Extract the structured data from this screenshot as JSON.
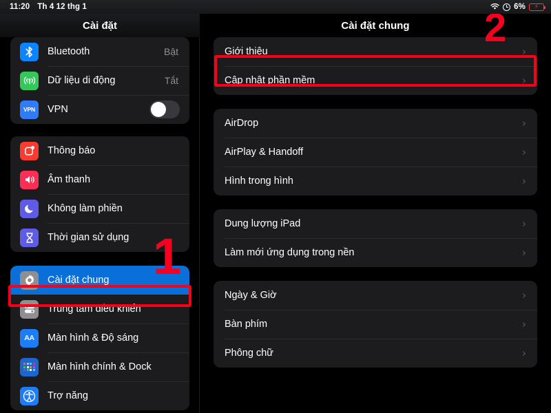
{
  "status_bar": {
    "time": "11:20",
    "date": "Th 4 12 thg 1",
    "wifi_icon": "wifi-icon",
    "lock_icon": "screen-lock-rotation-icon",
    "battery_percent": "6%",
    "battery_icon": "battery-charging-icon",
    "bolt": "⚡"
  },
  "left_pane": {
    "title": "Cài đặt",
    "groups": [
      {
        "items": [
          {
            "label": "Bluetooth",
            "value": "Bật",
            "icon": "bluetooth-icon",
            "accessory": "value"
          },
          {
            "label": "Dữ liệu di động",
            "value": "Tắt",
            "icon": "cellular-data-icon",
            "accessory": "value"
          },
          {
            "label": "VPN",
            "value": "",
            "icon": "vpn-icon",
            "accessory": "toggle",
            "toggle_on": false
          }
        ]
      },
      {
        "items": [
          {
            "label": "Thông báo",
            "value": "",
            "icon": "notifications-icon",
            "accessory": "none"
          },
          {
            "label": "Âm thanh",
            "value": "",
            "icon": "sounds-icon",
            "accessory": "none"
          },
          {
            "label": "Không làm phiền",
            "value": "",
            "icon": "do-not-disturb-icon",
            "accessory": "none"
          },
          {
            "label": "Thời gian sử dụng",
            "value": "",
            "icon": "screen-time-icon",
            "accessory": "none"
          }
        ]
      },
      {
        "items": [
          {
            "label": "Cài đặt chung",
            "value": "",
            "icon": "gear-icon",
            "accessory": "none",
            "selected": true
          },
          {
            "label": "Trung tâm điều khiển",
            "value": "",
            "icon": "control-center-icon",
            "accessory": "none"
          },
          {
            "label": "Màn hình & Độ sáng",
            "value": "",
            "icon": "display-brightness-icon",
            "accessory": "none"
          },
          {
            "label": "Màn hình chính & Dock",
            "value": "",
            "icon": "home-screen-dock-icon",
            "accessory": "none"
          },
          {
            "label": "Trợ năng",
            "value": "",
            "icon": "accessibility-icon",
            "accessory": "none"
          }
        ]
      }
    ]
  },
  "right_pane": {
    "title": "Cài đặt chung",
    "chevron": "›",
    "groups": [
      {
        "items": [
          {
            "label": "Giới thiệu",
            "highlighted": true
          },
          {
            "label": "Cập nhật phần mềm",
            "highlighted": false
          }
        ]
      },
      {
        "items": [
          {
            "label": "AirDrop",
            "highlighted": false
          },
          {
            "label": "AirPlay & Handoff",
            "highlighted": false
          },
          {
            "label": "Hình trong hình",
            "highlighted": false
          }
        ]
      },
      {
        "items": [
          {
            "label": "Dung lượng iPad",
            "highlighted": false
          },
          {
            "label": "Làm mới ứng dụng trong nền",
            "highlighted": false
          }
        ]
      },
      {
        "items": [
          {
            "label": "Ngày & Giờ",
            "highlighted": false
          },
          {
            "label": "Bàn phím",
            "highlighted": false
          },
          {
            "label": "Phông chữ",
            "highlighted": false
          }
        ]
      }
    ]
  },
  "annotations": {
    "step_one": "1",
    "step_two": "2",
    "color": "#fa0016"
  },
  "colors": {
    "selected_row": "#0a6fd8",
    "card": "#1c1c1e",
    "separator": "#2c2c2e",
    "secondary_text": "#8e8e93",
    "bluetooth": "#0a84ff",
    "cellular": "#34c759",
    "vpn": "#2f7cf6",
    "notifications": "#fa3b30",
    "sounds": "#fc2e55",
    "dnd": "#5e5ce6",
    "screen_time": "#5e5ce6",
    "gear": "#8e8e93",
    "control_center": "#8e8e93",
    "display": "#1d7df7",
    "home_dock": "#1d66d0",
    "accessibility": "#1d7df7",
    "battery": "#ff3b30"
  }
}
